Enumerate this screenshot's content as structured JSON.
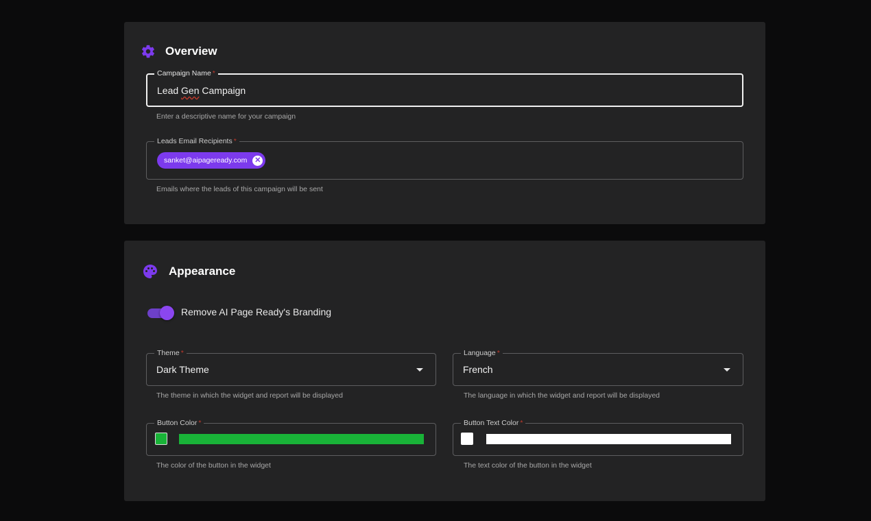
{
  "overview": {
    "title": "Overview",
    "icon": "gear-icon",
    "campaign_name": {
      "label": "Campaign Name",
      "required": "*",
      "value": "Lead Gen Campaign",
      "helper": "Enter a descriptive name for your campaign"
    },
    "email_recipients": {
      "label": "Leads Email Recipients",
      "required": "*",
      "chips": [
        "sanket@aipageready.com"
      ],
      "helper": "Emails where the leads of this campaign will be sent"
    }
  },
  "appearance": {
    "title": "Appearance",
    "icon": "palette-icon",
    "branding_toggle": {
      "label": "Remove AI Page Ready's Branding",
      "checked": true
    },
    "theme": {
      "label": "Theme",
      "required": "*",
      "value": "Dark Theme",
      "helper": "The theme in which the widget and report will be displayed"
    },
    "language": {
      "label": "Language",
      "required": "*",
      "value": "French",
      "helper": "The language in which the widget and report will be displayed"
    },
    "button_color": {
      "label": "Button Color",
      "required": "*",
      "color": "#19b338",
      "helper": "The color of the button in the widget"
    },
    "button_text_color": {
      "label": "Button Text Color",
      "required": "*",
      "color": "#ffffff",
      "helper": "The text color of the button in the widget"
    }
  },
  "colors": {
    "accent": "#7c3aed",
    "card_bg": "#232324",
    "page_bg": "#0b0b0c"
  }
}
